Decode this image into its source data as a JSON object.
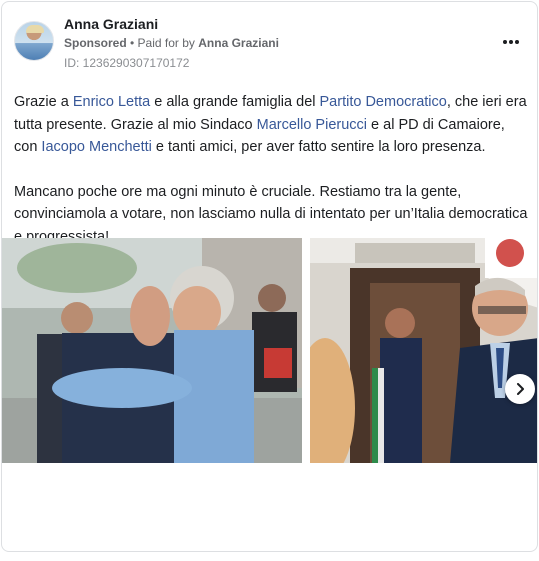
{
  "post": {
    "author": "Anna Graziani",
    "sponsored_label": "Sponsored",
    "paid_for_prefix": " • Paid for by ",
    "paid_for_by": "Anna Graziani",
    "ad_id": "ID: 1236290307170172"
  },
  "body": {
    "p1": {
      "t1": "Grazie a ",
      "link1": "Enrico Letta",
      "t2": " e alla grande famiglia del ",
      "link2": "Partito Democratico",
      "t3": ", che ieri era tutta presente. Grazie al mio Sindaco ",
      "link3": "Marcello Pierucci",
      "t4": " e al PD di Camaiore, con ",
      "link4": "Iacopo Menchetti",
      "t5": " e tanti amici, per aver fatto sentire la loro presenza."
    },
    "p2": "Mancano poche ore ma ogni minuto è cruciale. Restiamo tra la gente, convinciamola a votare, non lasciamo nulla di intentato per un’Italia democratica e progressista!..."
  },
  "icons": {
    "more": "more-options-icon",
    "next": "chevron-right-icon"
  },
  "colors": {
    "link": "#385898",
    "secondary_text": "#65676b",
    "border": "#dddfe2"
  }
}
